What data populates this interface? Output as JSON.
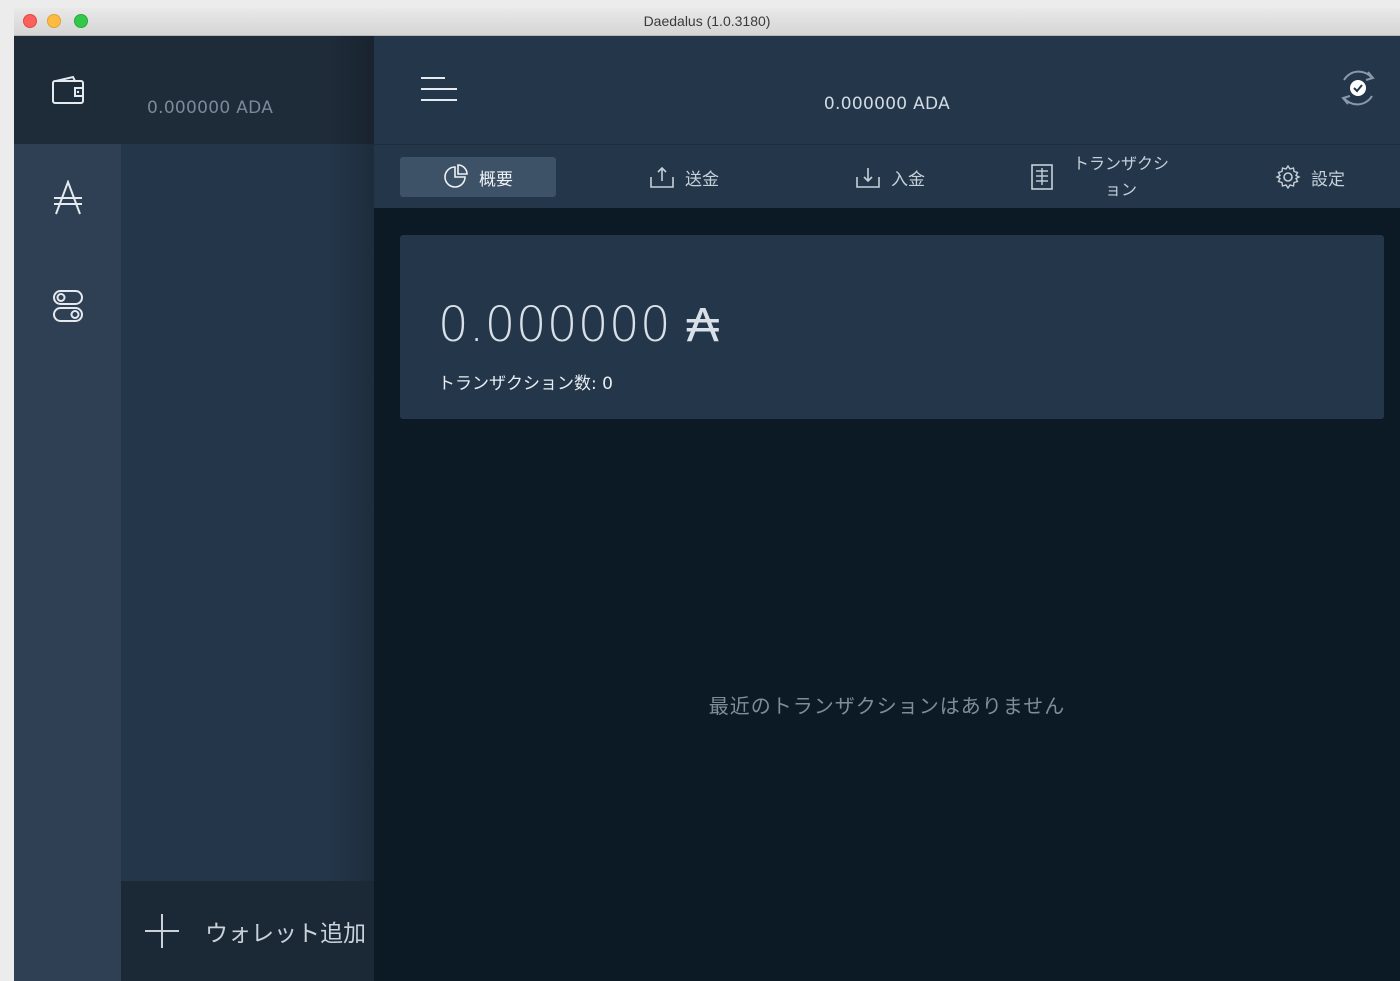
{
  "window": {
    "title": "Daedalus (1.0.3180)"
  },
  "rail": {
    "items": [
      {
        "icon": "wallet-icon"
      },
      {
        "icon": "ada-icon"
      },
      {
        "icon": "settings-toggle-icon"
      }
    ]
  },
  "wallets": {
    "selected_balance": "0.000000 ADA",
    "add_wallet_label": "ウォレット追加"
  },
  "topbar": {
    "balance": "0.000000 ADA"
  },
  "tabs": {
    "summary": "概要",
    "send": "送金",
    "receive": "入金",
    "transactions_line1": "トランザクシ",
    "transactions_line2": "ョン",
    "settings": "設定"
  },
  "summary": {
    "amount": "0.000000",
    "currency_symbol": "₳",
    "tx_count_label": "トランザクション数: 0"
  },
  "empty_state": "最近のトランザクションはありません",
  "colors": {
    "rail": "#2f4054",
    "panel": "#24364a",
    "background": "#0c1a25",
    "active_tab": "#3d5167"
  }
}
